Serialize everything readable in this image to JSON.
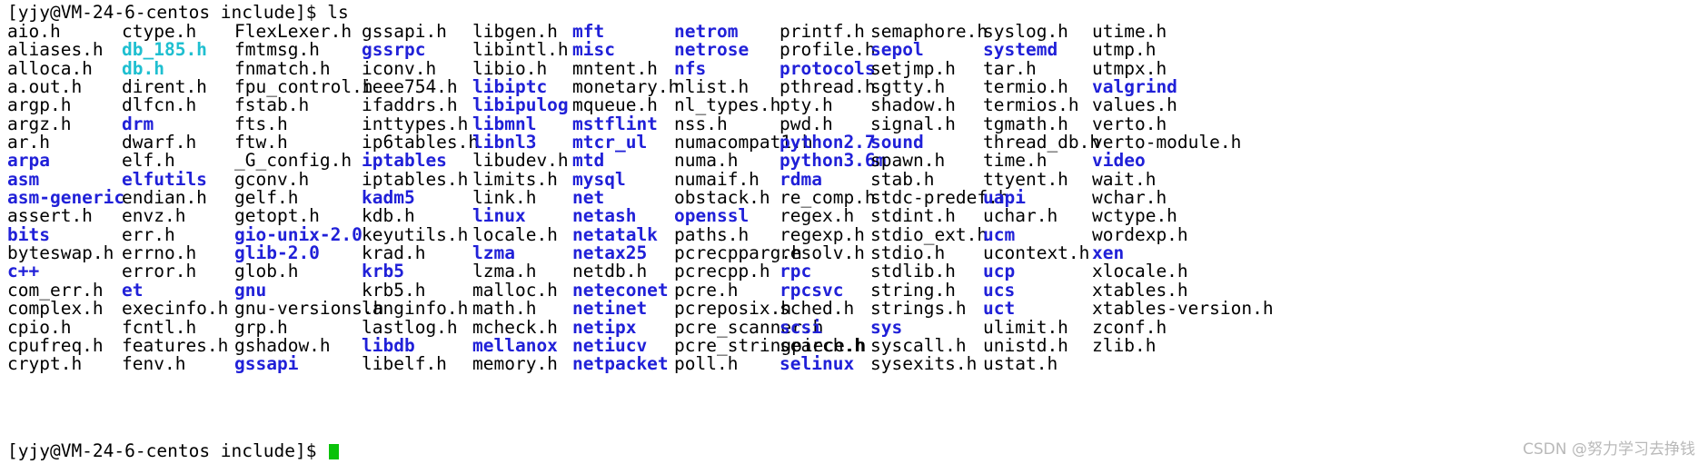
{
  "terminal": {
    "prompt": "[yjy@VM-24-6-centos include]$ ls",
    "bottom_prompt": "[yjy@VM-24-6-centos include]$ ",
    "watermark": "CSDN @努力学习去挣钱",
    "colors": {
      "background": "#ffffff",
      "file": "#000000",
      "directory": "#2020d8",
      "archive": "#1fbfd0",
      "cursor": "#0ac20a",
      "watermark": "#b9b9b9"
    }
  },
  "listing": {
    "columns": [
      {
        "index": 0,
        "entries": [
          {
            "name": "aio.h",
            "type": "file"
          },
          {
            "name": "aliases.h",
            "type": "file"
          },
          {
            "name": "alloca.h",
            "type": "file"
          },
          {
            "name": "a.out.h",
            "type": "file"
          },
          {
            "name": "argp.h",
            "type": "file"
          },
          {
            "name": "argz.h",
            "type": "file"
          },
          {
            "name": "ar.h",
            "type": "file"
          },
          {
            "name": "arpa",
            "type": "dir"
          },
          {
            "name": "asm",
            "type": "dir"
          },
          {
            "name": "asm-generic",
            "type": "dir"
          },
          {
            "name": "assert.h",
            "type": "file"
          },
          {
            "name": "bits",
            "type": "dir"
          },
          {
            "name": "byteswap.h",
            "type": "file"
          },
          {
            "name": "c++",
            "type": "dir"
          },
          {
            "name": "com_err.h",
            "type": "file"
          },
          {
            "name": "complex.h",
            "type": "file"
          },
          {
            "name": "cpio.h",
            "type": "file"
          },
          {
            "name": "cpufreq.h",
            "type": "file"
          },
          {
            "name": "crypt.h",
            "type": "file"
          }
        ]
      },
      {
        "index": 1,
        "entries": [
          {
            "name": "ctype.h",
            "type": "file"
          },
          {
            "name": "db_185.h",
            "type": "archive"
          },
          {
            "name": "db.h",
            "type": "archive"
          },
          {
            "name": "dirent.h",
            "type": "file"
          },
          {
            "name": "dlfcn.h",
            "type": "file"
          },
          {
            "name": "drm",
            "type": "dir"
          },
          {
            "name": "dwarf.h",
            "type": "file"
          },
          {
            "name": "elf.h",
            "type": "file"
          },
          {
            "name": "elfutils",
            "type": "dir"
          },
          {
            "name": "endian.h",
            "type": "file"
          },
          {
            "name": "envz.h",
            "type": "file"
          },
          {
            "name": "err.h",
            "type": "file"
          },
          {
            "name": "errno.h",
            "type": "file"
          },
          {
            "name": "error.h",
            "type": "file"
          },
          {
            "name": "et",
            "type": "dir"
          },
          {
            "name": "execinfo.h",
            "type": "file"
          },
          {
            "name": "fcntl.h",
            "type": "file"
          },
          {
            "name": "features.h",
            "type": "file"
          },
          {
            "name": "fenv.h",
            "type": "file"
          }
        ]
      },
      {
        "index": 2,
        "entries": [
          {
            "name": "FlexLexer.h",
            "type": "file"
          },
          {
            "name": "fmtmsg.h",
            "type": "file"
          },
          {
            "name": "fnmatch.h",
            "type": "file"
          },
          {
            "name": "fpu_control.h",
            "type": "file"
          },
          {
            "name": "fstab.h",
            "type": "file"
          },
          {
            "name": "fts.h",
            "type": "file"
          },
          {
            "name": "ftw.h",
            "type": "file"
          },
          {
            "name": "_G_config.h",
            "type": "file"
          },
          {
            "name": "gconv.h",
            "type": "file"
          },
          {
            "name": "gelf.h",
            "type": "file"
          },
          {
            "name": "getopt.h",
            "type": "file"
          },
          {
            "name": "gio-unix-2.0",
            "type": "dir"
          },
          {
            "name": "glib-2.0",
            "type": "dir"
          },
          {
            "name": "glob.h",
            "type": "file"
          },
          {
            "name": "gnu",
            "type": "dir"
          },
          {
            "name": "gnu-versions.h",
            "type": "file"
          },
          {
            "name": "grp.h",
            "type": "file"
          },
          {
            "name": "gshadow.h",
            "type": "file"
          },
          {
            "name": "gssapi",
            "type": "dir"
          }
        ]
      },
      {
        "index": 3,
        "entries": [
          {
            "name": "gssapi.h",
            "type": "file"
          },
          {
            "name": "gssrpc",
            "type": "dir"
          },
          {
            "name": "iconv.h",
            "type": "file"
          },
          {
            "name": "ieee754.h",
            "type": "file"
          },
          {
            "name": "ifaddrs.h",
            "type": "file"
          },
          {
            "name": "inttypes.h",
            "type": "file"
          },
          {
            "name": "ip6tables.h",
            "type": "file"
          },
          {
            "name": "iptables",
            "type": "dir"
          },
          {
            "name": "iptables.h",
            "type": "file"
          },
          {
            "name": "kadm5",
            "type": "dir"
          },
          {
            "name": "kdb.h",
            "type": "file"
          },
          {
            "name": "keyutils.h",
            "type": "file"
          },
          {
            "name": "krad.h",
            "type": "file"
          },
          {
            "name": "krb5",
            "type": "dir"
          },
          {
            "name": "krb5.h",
            "type": "file"
          },
          {
            "name": "langinfo.h",
            "type": "file"
          },
          {
            "name": "lastlog.h",
            "type": "file"
          },
          {
            "name": "libdb",
            "type": "dir"
          },
          {
            "name": "libelf.h",
            "type": "file"
          }
        ]
      },
      {
        "index": 4,
        "entries": [
          {
            "name": "libgen.h",
            "type": "file"
          },
          {
            "name": "libintl.h",
            "type": "file"
          },
          {
            "name": "libio.h",
            "type": "file"
          },
          {
            "name": "libiptc",
            "type": "dir"
          },
          {
            "name": "libipulog",
            "type": "dir"
          },
          {
            "name": "libmnl",
            "type": "dir"
          },
          {
            "name": "libnl3",
            "type": "dir"
          },
          {
            "name": "libudev.h",
            "type": "file"
          },
          {
            "name": "limits.h",
            "type": "file"
          },
          {
            "name": "link.h",
            "type": "file"
          },
          {
            "name": "linux",
            "type": "dir"
          },
          {
            "name": "locale.h",
            "type": "file"
          },
          {
            "name": "lzma",
            "type": "dir"
          },
          {
            "name": "lzma.h",
            "type": "file"
          },
          {
            "name": "malloc.h",
            "type": "file"
          },
          {
            "name": "math.h",
            "type": "file"
          },
          {
            "name": "mcheck.h",
            "type": "file"
          },
          {
            "name": "mellanox",
            "type": "dir"
          },
          {
            "name": "memory.h",
            "type": "file"
          }
        ]
      },
      {
        "index": 5,
        "entries": [
          {
            "name": "mft",
            "type": "dir"
          },
          {
            "name": "misc",
            "type": "dir"
          },
          {
            "name": "mntent.h",
            "type": "file"
          },
          {
            "name": "monetary.h",
            "type": "file"
          },
          {
            "name": "mqueue.h",
            "type": "file"
          },
          {
            "name": "mstflint",
            "type": "dir"
          },
          {
            "name": "mtcr_ul",
            "type": "dir"
          },
          {
            "name": "mtd",
            "type": "dir"
          },
          {
            "name": "mysql",
            "type": "dir"
          },
          {
            "name": "net",
            "type": "dir"
          },
          {
            "name": "netash",
            "type": "dir"
          },
          {
            "name": "netatalk",
            "type": "dir"
          },
          {
            "name": "netax25",
            "type": "dir"
          },
          {
            "name": "netdb.h",
            "type": "file"
          },
          {
            "name": "neteconet",
            "type": "dir"
          },
          {
            "name": "netinet",
            "type": "dir"
          },
          {
            "name": "netipx",
            "type": "dir"
          },
          {
            "name": "netiucv",
            "type": "dir"
          },
          {
            "name": "netpacket",
            "type": "dir"
          }
        ]
      },
      {
        "index": 6,
        "entries": [
          {
            "name": "netrom",
            "type": "dir"
          },
          {
            "name": "netrose",
            "type": "dir"
          },
          {
            "name": "nfs",
            "type": "dir"
          },
          {
            "name": "nlist.h",
            "type": "file"
          },
          {
            "name": "nl_types.h",
            "type": "file"
          },
          {
            "name": "nss.h",
            "type": "file"
          },
          {
            "name": "numacompat1.h",
            "type": "file"
          },
          {
            "name": "numa.h",
            "type": "file"
          },
          {
            "name": "numaif.h",
            "type": "file"
          },
          {
            "name": "obstack.h",
            "type": "file"
          },
          {
            "name": "openssl",
            "type": "dir"
          },
          {
            "name": "paths.h",
            "type": "file"
          },
          {
            "name": "pcrecpparg.h",
            "type": "file"
          },
          {
            "name": "pcrecpp.h",
            "type": "file"
          },
          {
            "name": "pcre.h",
            "type": "file"
          },
          {
            "name": "pcreposix.h",
            "type": "file"
          },
          {
            "name": "pcre_scanner.h",
            "type": "file"
          },
          {
            "name": "pcre_stringpiece.h",
            "type": "file"
          },
          {
            "name": "poll.h",
            "type": "file"
          }
        ]
      },
      {
        "index": 7,
        "entries": [
          {
            "name": "printf.h",
            "type": "file"
          },
          {
            "name": "profile.h",
            "type": "file"
          },
          {
            "name": "protocols",
            "type": "dir"
          },
          {
            "name": "pthread.h",
            "type": "file"
          },
          {
            "name": "pty.h",
            "type": "file"
          },
          {
            "name": "pwd.h",
            "type": "file"
          },
          {
            "name": "python2.7",
            "type": "dir"
          },
          {
            "name": "python3.6m",
            "type": "dir"
          },
          {
            "name": "rdma",
            "type": "dir"
          },
          {
            "name": "re_comp.h",
            "type": "file"
          },
          {
            "name": "regex.h",
            "type": "file"
          },
          {
            "name": "regexp.h",
            "type": "file"
          },
          {
            "name": "resolv.h",
            "type": "file"
          },
          {
            "name": "rpc",
            "type": "dir"
          },
          {
            "name": "rpcsvc",
            "type": "dir"
          },
          {
            "name": "sched.h",
            "type": "file"
          },
          {
            "name": "scsi",
            "type": "dir"
          },
          {
            "name": "search.h",
            "type": "file"
          },
          {
            "name": "selinux",
            "type": "dir"
          }
        ]
      },
      {
        "index": 8,
        "entries": [
          {
            "name": "semaphore.h",
            "type": "file"
          },
          {
            "name": "sepol",
            "type": "dir"
          },
          {
            "name": "setjmp.h",
            "type": "file"
          },
          {
            "name": "sgtty.h",
            "type": "file"
          },
          {
            "name": "shadow.h",
            "type": "file"
          },
          {
            "name": "signal.h",
            "type": "file"
          },
          {
            "name": "sound",
            "type": "dir"
          },
          {
            "name": "spawn.h",
            "type": "file"
          },
          {
            "name": "stab.h",
            "type": "file"
          },
          {
            "name": "stdc-predef.h",
            "type": "file"
          },
          {
            "name": "stdint.h",
            "type": "file"
          },
          {
            "name": "stdio_ext.h",
            "type": "file"
          },
          {
            "name": "stdio.h",
            "type": "file"
          },
          {
            "name": "stdlib.h",
            "type": "file"
          },
          {
            "name": "string.h",
            "type": "file"
          },
          {
            "name": "strings.h",
            "type": "file"
          },
          {
            "name": "sys",
            "type": "dir"
          },
          {
            "name": "syscall.h",
            "type": "file"
          },
          {
            "name": "sysexits.h",
            "type": "file"
          }
        ]
      },
      {
        "index": 9,
        "entries": [
          {
            "name": "syslog.h",
            "type": "file"
          },
          {
            "name": "systemd",
            "type": "dir"
          },
          {
            "name": "tar.h",
            "type": "file"
          },
          {
            "name": "termio.h",
            "type": "file"
          },
          {
            "name": "termios.h",
            "type": "file"
          },
          {
            "name": "tgmath.h",
            "type": "file"
          },
          {
            "name": "thread_db.h",
            "type": "file"
          },
          {
            "name": "time.h",
            "type": "file"
          },
          {
            "name": "ttyent.h",
            "type": "file"
          },
          {
            "name": "uapi",
            "type": "dir"
          },
          {
            "name": "uchar.h",
            "type": "file"
          },
          {
            "name": "ucm",
            "type": "dir"
          },
          {
            "name": "ucontext.h",
            "type": "file"
          },
          {
            "name": "ucp",
            "type": "dir"
          },
          {
            "name": "ucs",
            "type": "dir"
          },
          {
            "name": "uct",
            "type": "dir"
          },
          {
            "name": "ulimit.h",
            "type": "file"
          },
          {
            "name": "unistd.h",
            "type": "file"
          },
          {
            "name": "ustat.h",
            "type": "file"
          }
        ]
      },
      {
        "index": 10,
        "entries": [
          {
            "name": "utime.h",
            "type": "file"
          },
          {
            "name": "utmp.h",
            "type": "file"
          },
          {
            "name": "utmpx.h",
            "type": "file"
          },
          {
            "name": "valgrind",
            "type": "dir"
          },
          {
            "name": "values.h",
            "type": "file"
          },
          {
            "name": "verto.h",
            "type": "file"
          },
          {
            "name": "verto-module.h",
            "type": "file"
          },
          {
            "name": "video",
            "type": "dir"
          },
          {
            "name": "wait.h",
            "type": "file"
          },
          {
            "name": "wchar.h",
            "type": "file"
          },
          {
            "name": "wctype.h",
            "type": "file"
          },
          {
            "name": "wordexp.h",
            "type": "file"
          },
          {
            "name": "xen",
            "type": "dir"
          },
          {
            "name": "xlocale.h",
            "type": "file"
          },
          {
            "name": "xtables.h",
            "type": "file"
          },
          {
            "name": "xtables-version.h",
            "type": "file"
          },
          {
            "name": "zconf.h",
            "type": "file"
          },
          {
            "name": "zlib.h",
            "type": "file"
          },
          {
            "name": "",
            "type": "empty"
          }
        ]
      }
    ]
  }
}
